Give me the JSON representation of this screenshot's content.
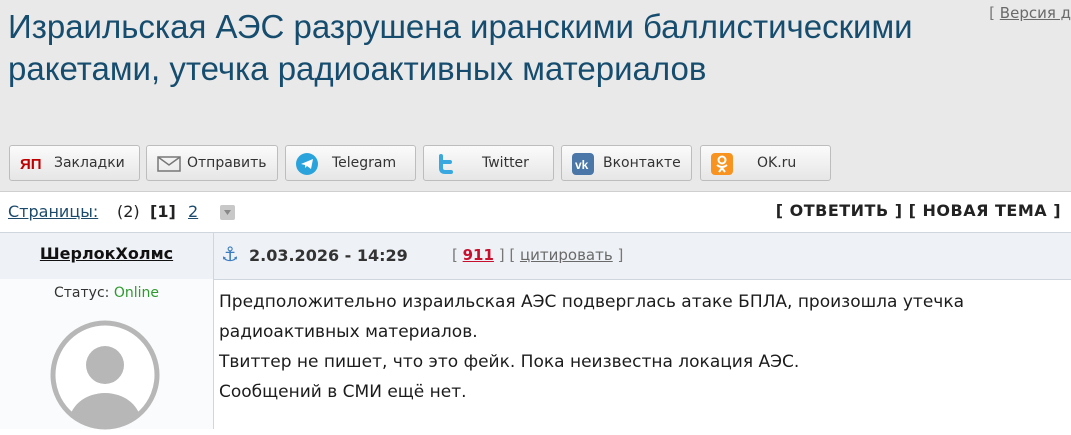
{
  "header": {
    "title": "Израильская АЭС разрушена иранскими баллистическими ракетами, утечка радиоактивных материалов",
    "version_prefix": "[ ",
    "version_link": "Версия д"
  },
  "share": [
    {
      "label": "Закладки",
      "icon": "yandex-bookmarks-icon",
      "color": "#c00000"
    },
    {
      "label": "Отправить",
      "icon": "envelope-icon",
      "color": "#777777"
    },
    {
      "label": "Telegram",
      "icon": "telegram-icon",
      "color": "#2aa3dc"
    },
    {
      "label": "Twitter",
      "icon": "twitter-icon",
      "color": "#39a8e0"
    },
    {
      "label": "Вконтакте",
      "icon": "vk-icon",
      "color": "#4a76a8"
    },
    {
      "label": "OK.ru",
      "icon": "odnoklassniki-icon",
      "color": "#f7931e"
    }
  ],
  "pagination": {
    "label": "Страницы:",
    "count": "(2)",
    "current": "[1]",
    "next": "2"
  },
  "actions": {
    "reply": "[ ОТВЕТИТЬ ]",
    "new_topic": "[ НОВАЯ ТЕМА ]"
  },
  "post": {
    "author": "ШерлокХолмс",
    "date": "2.03.2026 - 14:29",
    "number": "911",
    "quote": "цитировать",
    "status_label": "Статус:",
    "status_value": "Online",
    "lines": [
      "Предположительно израильская АЭС подверглась атаке БПЛА, произошла утечка",
      "радиоактивных материалов.",
      "Твиттер не пишет, что это фейк. Пока неизвестна локация АЭС.",
      "Сообщений в СМИ ещё нет."
    ]
  }
}
